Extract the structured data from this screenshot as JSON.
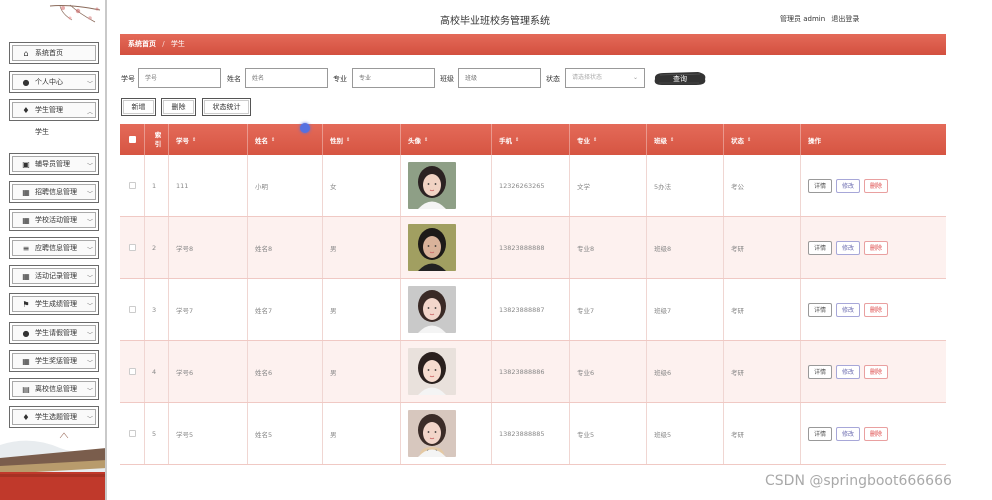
{
  "app": {
    "title": "高校毕业班校务管理系统",
    "user_label": "管理员 admin",
    "logout_label": "退出登录"
  },
  "sidebar": {
    "items": [
      {
        "label": "系统首页",
        "icon": "home-icon",
        "has_chevron": false
      },
      {
        "label": "个人中心",
        "icon": "user-icon",
        "has_chevron": true
      },
      {
        "label": "学生管理",
        "icon": "pin-icon",
        "has_chevron": true,
        "expanded": true
      },
      {
        "label": "辅导员管理",
        "icon": "id-card-icon",
        "has_chevron": true
      },
      {
        "label": "招聘信息管理",
        "icon": "grid-icon",
        "has_chevron": true
      },
      {
        "label": "学校活动管理",
        "icon": "grid-icon",
        "has_chevron": true
      },
      {
        "label": "应聘信息管理",
        "icon": "list-icon",
        "has_chevron": true
      },
      {
        "label": "活动记录管理",
        "icon": "grid-icon",
        "has_chevron": true
      },
      {
        "label": "学生成绩管理",
        "icon": "flag-icon",
        "has_chevron": true
      },
      {
        "label": "学生请假管理",
        "icon": "user-icon",
        "has_chevron": true
      },
      {
        "label": "学生奖惩管理",
        "icon": "grid-icon",
        "has_chevron": true
      },
      {
        "label": "离校信息管理",
        "icon": "calendar-icon",
        "has_chevron": true
      },
      {
        "label": "学生选题管理",
        "icon": "pin-icon",
        "has_chevron": true
      }
    ],
    "sub_item": "学生"
  },
  "breadcrumb": {
    "home": "系统首页",
    "separator": "/",
    "current": "学生"
  },
  "search": {
    "no_label": "学号",
    "no_placeholder": "学号",
    "name_label": "姓名",
    "name_placeholder": "姓名",
    "major_label": "专业",
    "major_placeholder": "专业",
    "class_label": "班级",
    "class_placeholder": "班级",
    "status_label": "状态",
    "status_placeholder": "请选择状态",
    "query_label": "查询"
  },
  "actions": {
    "add": "新增",
    "delete": "删除",
    "stats": "状态统计"
  },
  "table": {
    "headers": [
      "索引",
      "学号",
      "姓名",
      "性别",
      "头像",
      "手机",
      "专业",
      "班级",
      "状态",
      "操作"
    ],
    "rows": [
      {
        "idx": "1",
        "no": "111",
        "name": "小明",
        "sex": "女",
        "phone": "12326263265",
        "major": "文学",
        "cls": "5办法",
        "status": "考公",
        "avatar": "avatar-1"
      },
      {
        "idx": "2",
        "no": "学号8",
        "name": "姓名8",
        "sex": "男",
        "phone": "13823888888",
        "major": "专业8",
        "cls": "班级8",
        "status": "考研",
        "avatar": "avatar-2"
      },
      {
        "idx": "3",
        "no": "学号7",
        "name": "姓名7",
        "sex": "男",
        "phone": "13823888887",
        "major": "专业7",
        "cls": "班级7",
        "status": "考研",
        "avatar": "avatar-3"
      },
      {
        "idx": "4",
        "no": "学号6",
        "name": "姓名6",
        "sex": "男",
        "phone": "13823888886",
        "major": "专业6",
        "cls": "班级6",
        "status": "考研",
        "avatar": "avatar-4"
      },
      {
        "idx": "5",
        "no": "学号5",
        "name": "姓名5",
        "sex": "男",
        "phone": "13823888885",
        "major": "专业5",
        "cls": "班级5",
        "status": "考研",
        "avatar": "avatar-5"
      }
    ],
    "row_actions": {
      "detail": "详情",
      "edit": "修改",
      "delete": "删除"
    }
  },
  "watermark": "CSDN @springboot666666",
  "colors": {
    "accent": "#d9574a",
    "row_alt": "#fdf1ef"
  }
}
